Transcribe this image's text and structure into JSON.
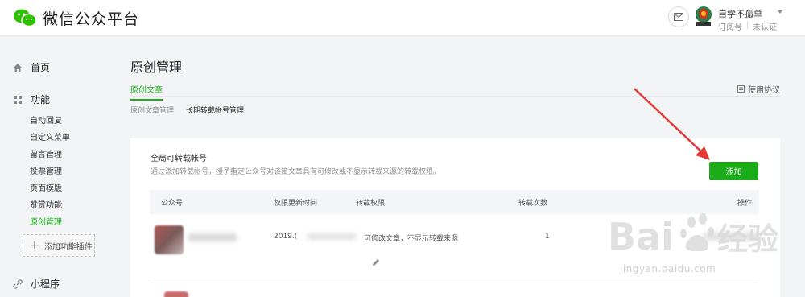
{
  "header": {
    "app_title": "微信公众平台",
    "account_name": "自学不孤单",
    "account_type": "订阅号",
    "account_status": "未认证"
  },
  "sidebar": {
    "home": "首页",
    "features": "功能",
    "feature_items": [
      "自动回复",
      "自定义菜单",
      "留言管理",
      "投票管理",
      "页面模版",
      "赞赏功能",
      "原创管理"
    ],
    "active_item": "原创管理",
    "add_plugin": "添加功能插件",
    "mini_program": "小程序"
  },
  "main": {
    "title": "原创管理",
    "tab_active": "原创文章",
    "agreement": "使用协议",
    "subtabs": [
      "原创文章管理",
      "长期转载帐号管理"
    ],
    "card": {
      "title": "全局可转载帐号",
      "description": "通过添加转载帐号，授予指定公众号对该篇文章具有可修改或不显示转载来源的转载权限。",
      "add_button": "添加",
      "columns": [
        "公众号",
        "权限更新时间",
        "转载权限",
        "转载次数",
        "操作"
      ],
      "rows": [
        {
          "date_visible": "2019.(",
          "permission": "可修改文章，不显示转载来源",
          "count": "1"
        }
      ]
    }
  },
  "colors": {
    "brand_green": "#1aad19",
    "annotation_red": "#e53935"
  },
  "watermark": {
    "text": "jingyan.baidu.com"
  }
}
